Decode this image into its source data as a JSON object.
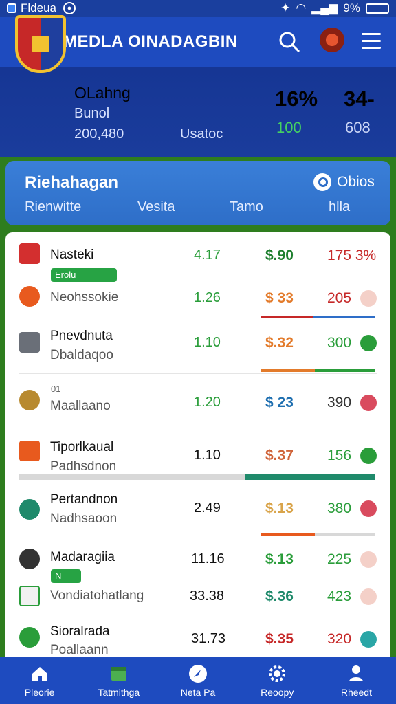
{
  "status_bar": {
    "app": "Fldeua",
    "battery": "9%"
  },
  "header": {
    "title": "MEDLA OINADAGBIN"
  },
  "club": {
    "name": "OLahng",
    "subtitle": "Bunol",
    "number": "200,480",
    "status": "Usatoc",
    "stat_a": "16%",
    "stat_b": "34-",
    "stat_a_sub": "100",
    "stat_b_sub": "608"
  },
  "filter": {
    "title": "Riehahagan",
    "action": "Obios",
    "columns": [
      "Rienwitte",
      "Vesita",
      "Tamo",
      "hlla"
    ]
  },
  "rows": [
    {
      "name": "Nasteki",
      "odd": "4.17",
      "price": "$.90",
      "score": "175 3%"
    },
    {
      "tag": "Erolu",
      "name": "Neohssokie",
      "odd": "1.26",
      "price": "$ 33",
      "score": "205"
    },
    {
      "name": "Pnevdnuta",
      "sub": "Dbaldaqoo",
      "odd": "1.10",
      "price": "$.32",
      "score": "300"
    },
    {
      "tag": "01",
      "name": "Maallaano",
      "odd": "1.20",
      "price": "$ 23",
      "score": "390"
    },
    {
      "name": "Tiporlkaual",
      "sub": "Padhsdnon",
      "odd": "1.10",
      "price": "$.37",
      "score": "156"
    },
    {
      "name": "Pertandnon",
      "sub": "Nadhsaoon",
      "odd": "2.49",
      "price": "$.13",
      "score": "380"
    },
    {
      "name": "Madaragiia",
      "odd": "11.16",
      "price": "$.13",
      "score": "225"
    },
    {
      "tag": "N",
      "name": "Vondiatohatlang",
      "odd": "33.38",
      "price": "$.36",
      "score": "423"
    },
    {
      "name": "Sioralrada",
      "sub": "Poallaann",
      "odd": "31.73",
      "price": "$.35",
      "score": "320"
    }
  ],
  "nav": [
    "Pleorie",
    "Tatmithga",
    "Neta Pa",
    "Reoopy",
    "Rheedt"
  ],
  "colors": {
    "primary": "#1e4bbf",
    "green": "#2a9d3a",
    "red": "#c62828",
    "orange": "#e37b2b",
    "teal": "#1f8a6b"
  }
}
